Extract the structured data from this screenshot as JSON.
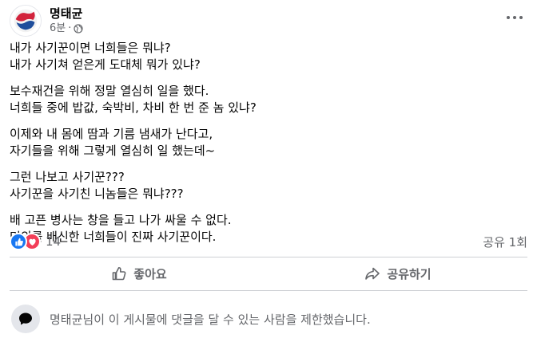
{
  "post": {
    "author": "명태균",
    "time": "6분",
    "separator": "·",
    "paragraphs": [
      [
        "내가 사기꾼이면 너희들은 뭐냐?",
        "내가 사기쳐 얻은게 도대체 뭐가 있냐?"
      ],
      [
        "보수재건을 위해 정말 열심히 일을 했다.",
        "너희들 중에 밥값, 숙박비, 차비 한 번 준 놈 있냐?"
      ],
      [
        "이제와 내 몸에 땀과 기름 냄새가 난다고,",
        "자기들을 위해 그렇게 열심히 일 했는데~"
      ],
      [
        "그런 나보고  사기꾼???",
        "사기꾼을 사기친 니놈들은 뭐냐???"
      ],
      [
        "배 고픈 병사는 창을 들고 나가 싸울 수 없다.",
        "민의를 배신한 너희들이 진짜 사기꾼이다."
      ]
    ]
  },
  "engagement": {
    "reaction_count": "14",
    "shares": "공유 1회"
  },
  "actions": {
    "like": "좋아요",
    "share": "공유하기"
  },
  "comment_notice": "명태균님이 이 게시물에 댓글을 달 수 있는 사람을 제한했습니다.",
  "colors": {
    "like_blue": "#1877f2",
    "love_red": "#f33e58",
    "secondary_text": "#65676b"
  }
}
